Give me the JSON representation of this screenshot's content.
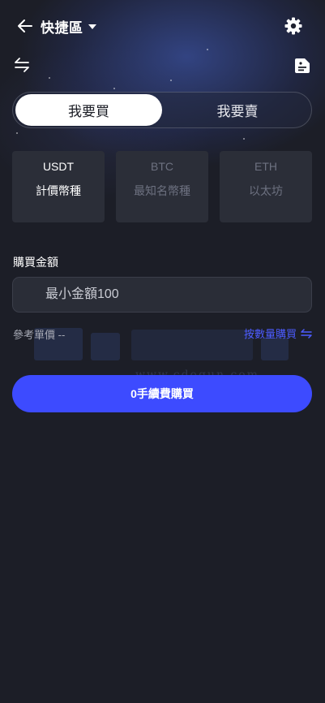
{
  "header": {
    "title": "快捷區",
    "back_icon": "arrow-left-icon",
    "settings_icon": "gear-icon"
  },
  "toolbar": {
    "swap_icon": "swap-arrows-icon",
    "orders_icon": "document-icon"
  },
  "trade_tabs": [
    {
      "label": "我要買",
      "selected": true
    },
    {
      "label": "我要賣",
      "selected": false
    }
  ],
  "currencies": [
    {
      "symbol": "USDT",
      "name": "計價幣種",
      "active": true
    },
    {
      "symbol": "BTC",
      "name": "最知名幣種",
      "active": false
    },
    {
      "symbol": "ETH",
      "name": "以太坊",
      "active": false
    }
  ],
  "amount": {
    "label": "購買金額",
    "placeholder": "最小金額100",
    "value": ""
  },
  "reference_price": "參考單價 --",
  "quantity_link": "按數量購買",
  "watermark_text": "www.cdogun.com",
  "submit_label": "0手續費購買",
  "colors": {
    "background": "#1c1e27",
    "accent": "#3d4bff",
    "link": "#4d5cff",
    "card": "#2b2e38"
  }
}
